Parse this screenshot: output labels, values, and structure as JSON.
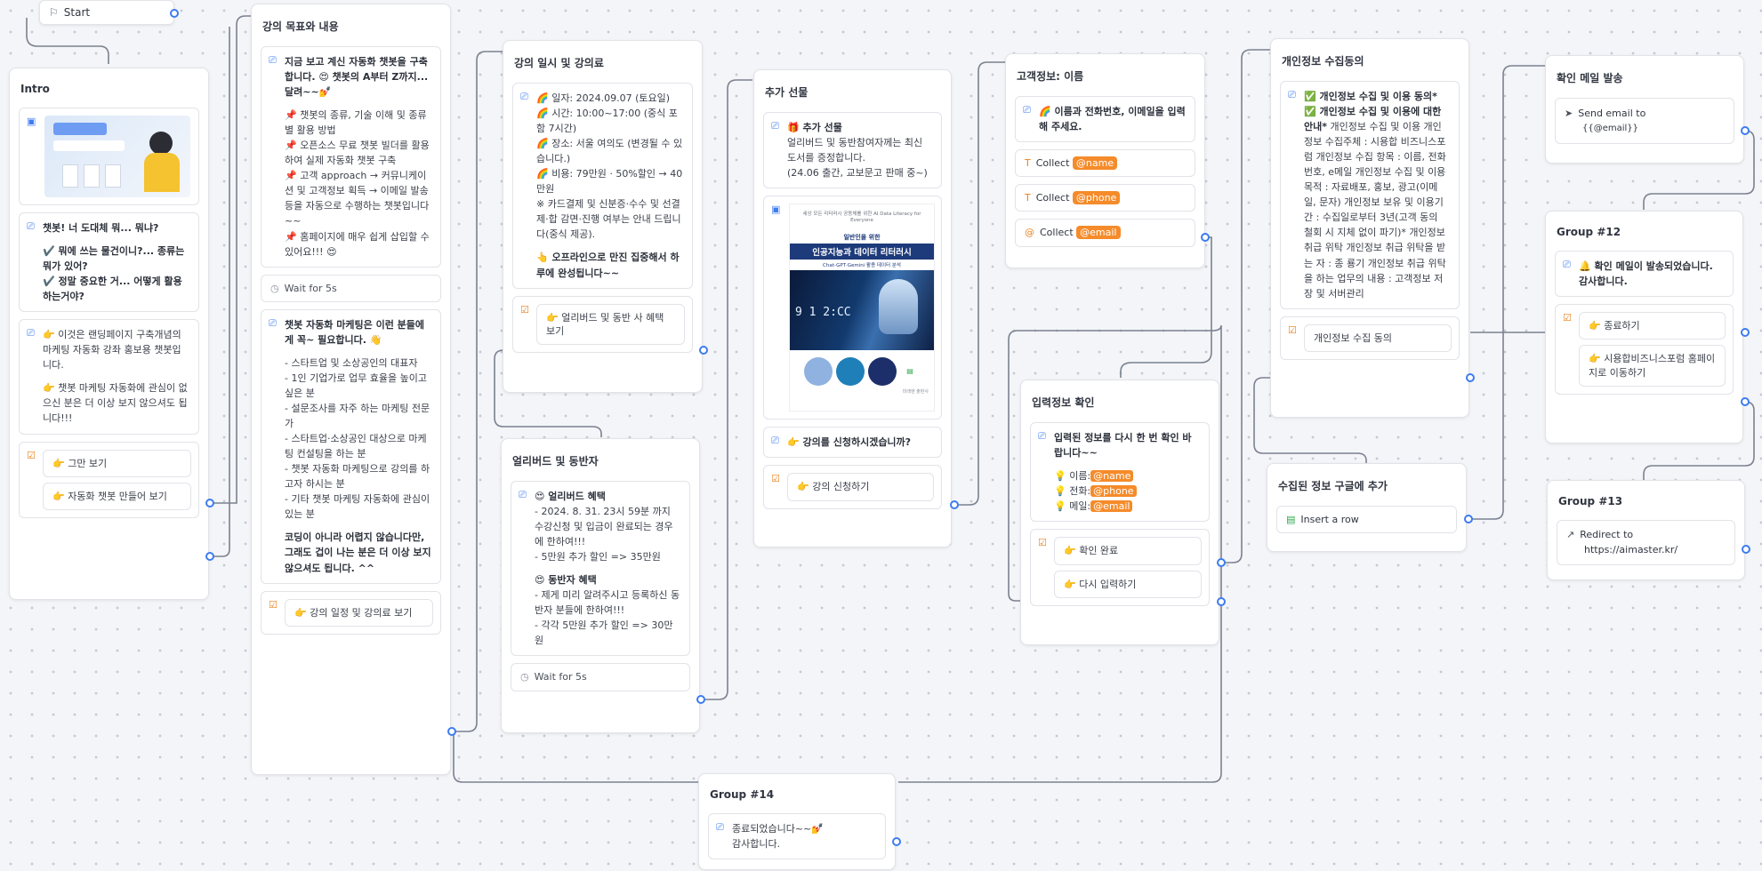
{
  "start": {
    "label": "Start"
  },
  "intro": {
    "title": "Intro",
    "q1": [
      "챗봇! 너 도대체 뭐... 뭐냐?"
    ],
    "q2": [
      "✔️ 뭐에 쓰는 물건이니?... 종류는 뭐가 있어?",
      "✔️ 정말 중요한 거... 어떻게 활용하는거야?"
    ],
    "t2": [
      "👉 이것은 랜딩페이지 구축개념의 마케팅 자동화 강좌 홍보용 챗봇입니다.",
      "👉 챗봇 마케팅 자동화에 관심이 없으신 분은 더 이상 보지 않으셔도 됩니다!!!"
    ],
    "buttons": [
      "👉 그만 보기",
      "👉 자동화 챗봇 만들어 보기"
    ]
  },
  "goals": {
    "title": "강의 목표와 내용",
    "t1": [
      "지금 보고 계신 자동화 챗봇을 구축합니다. 😍 챗봇의 A부터 Z까지... 달려~~💅"
    ],
    "t1list": [
      "📌 챗봇의 종류, 기술 이해 및 종류별 활용 방법",
      "📌 오픈소스 무료 챗봇 빌더를 활용하여 실제 자동화 챗봇 구축",
      "📌 고객 approach → 커뮤니케이션 및 고객정보 획득 → 이메일 발송 등을 자동으로 수행하는 챗봇입니다~~",
      "📌 홈페이지에 매우 쉽게 삽입할 수 있어요!!! 😍"
    ],
    "wait": "Wait for 5s",
    "t2": [
      "챗봇 자동화 마케팅은 이런 분들에게 꼭~ 필요합니다. 👋"
    ],
    "t2list": [
      "- 스타트업 및 소상공인의 대표자",
      "- 1인 기업가로 업무 효율을 높이고 싶은 분",
      "- 설문조사를 자주 하는 마케팅 전문가",
      "- 스타트업·소상공인 대상으로 마케팅 컨설팅을 하는 분",
      "- 챗봇 자동화 마케팅으로 강의를 하고자 하시는 분",
      "- 기타 챗봇 마케팅 자동화에 관심이 있는 분"
    ],
    "t2end": [
      "코딩이 아니라 어렵지 않습니다만, 그래도 겁이 나는 분은 더 이상 보지 않으셔도 됩니다. ^^"
    ],
    "button": "👉 강의 일정 및 강의료 보기"
  },
  "schedule": {
    "title": "강의 일시 및 강의료",
    "t1": [
      "🌈 일자: 2024.09.07 (토요일)",
      "🌈 시간: 10:00~17:00 (중식 포함 7시간)",
      "🌈 장소: 서울 여의도 (변경될 수 있습니다.)",
      "🌈 비용: 79만원 · 50%할인 → 40만원"
    ],
    "t1note": [
      "※ 카드결제 및 신분증·수수 및 선결제·합 감면·진행 여부는 안내 드립니다(중식 제공)."
    ],
    "t1end": [
      "👆 오프라인으로 만진 집중해서 하루에 완성됩니다~~"
    ],
    "button": "👉 얼리버드 및 동반 사 혜택 보기"
  },
  "early": {
    "title": "얼리버드 및 동반자",
    "h1": "😍 얼리버드 혜택",
    "l1": [
      "- 2024. 8. 31. 23시 59분 까지 수강신청 및 입금이 완료되는 경우에 한하여!!!",
      "- 5만원 추가 할인 => 35만원"
    ],
    "h2": "😍 동반자 혜택",
    "l2": [
      "- 제게 미리 알려주시고 등록하신 동반자 분들에 한하여!!!",
      "- 각각 5만원 추가 할인 => 30만원"
    ],
    "wait": "Wait for 5s"
  },
  "gift": {
    "title": "추가 선물",
    "t1h": "🎁 추가 선물",
    "t1": [
      "얼리버드 및 동반참여자께는 최신 도서를 증정합니다.",
      "(24.06 출간, 교보문고 판매 중~)"
    ],
    "book": {
      "top": "세상 모든 리터러시 공동체를 위한 AI Data Literacy for Everyone",
      "sub": "일반인을 위한",
      "title": "인공지능과 데이터 리터러시",
      "tag": "Chat-GPT·Gemini 활용 데이터 분석",
      "code": "9 1 2:CC",
      "footer": "미래엔 출판사"
    },
    "t2": "👉 강의를 신청하시겠습니까?",
    "button": "👉 강의 신청하기"
  },
  "customer": {
    "title": "고객정보: 이름",
    "t1": [
      "🌈 이름과 전화번호, 이메일을 입력해 주세요."
    ],
    "collect_label": "Collect",
    "collects": [
      "@name",
      "@phone",
      "@email"
    ]
  },
  "consent": {
    "title": "개인정보 수집동의",
    "t1b": "✅ 개인정보 수집 및 이용 동의* ✅ 개인정보 수집 및 이용에 대한 안내*",
    "t1": " 개인정보 수집 및 이용 개인정보 수집주체 : 시용합 비즈니스포럼 개인정보 수집 항목 : 이름, 전화번호, e메일 개인정보 수집 및 이용목적 : 자료배포, 홍보, 광고(이메일, 문자) 개인정보 보유 및 이용기간 : 수집일로부터 3년(고객 동의 철회 시 지체 없이 파기)* 개인정보 취급 위탁 개인정보 취급 위탁을 받는 자 : 종 룡기 개인정보 취급 위탁을 하는 업무의 내용 : 고객정보 저장 및 서버관리",
    "button": "개인정보 수집 동의"
  },
  "confirm": {
    "title": "입력정보 확인",
    "t1": "입력된 정보를 다시 한 번 확인 바랍니다~~",
    "rows": [
      {
        "k": "💡 이름:",
        "v": "@name"
      },
      {
        "k": "💡 전화:",
        "v": "@phone"
      },
      {
        "k": "💡 메일:",
        "v": "@email"
      }
    ],
    "buttons": [
      "👉 확인 완료",
      "👉 다시 입력하기"
    ]
  },
  "sheet": {
    "title": "수집된 정보 구글에 추가",
    "action": "Insert a row"
  },
  "mail": {
    "title": "확인 메일 발송",
    "label": "Send email to",
    "to": "{{@email}}"
  },
  "g12": {
    "title": "Group #12",
    "t1": "🔔 확인 메일이 발송되었습니다. 감사합니다.",
    "buttons": [
      "👉 종료하기",
      "👉 시용합비즈니스포럼 홈페이지로 이동하기"
    ]
  },
  "g13": {
    "title": "Group #13",
    "label": "Redirect to",
    "url": "https://aimaster.kr/"
  },
  "g14": {
    "title": "Group #14",
    "t1": [
      "종료되었습니다~~💅",
      "감사합니다."
    ]
  },
  "colors": {
    "accent": "#3d7bf0",
    "variable": "#f58b2a",
    "edge": "#7a8190",
    "node_border": "#e1e3e8",
    "canvas": "#f4f5f8"
  }
}
